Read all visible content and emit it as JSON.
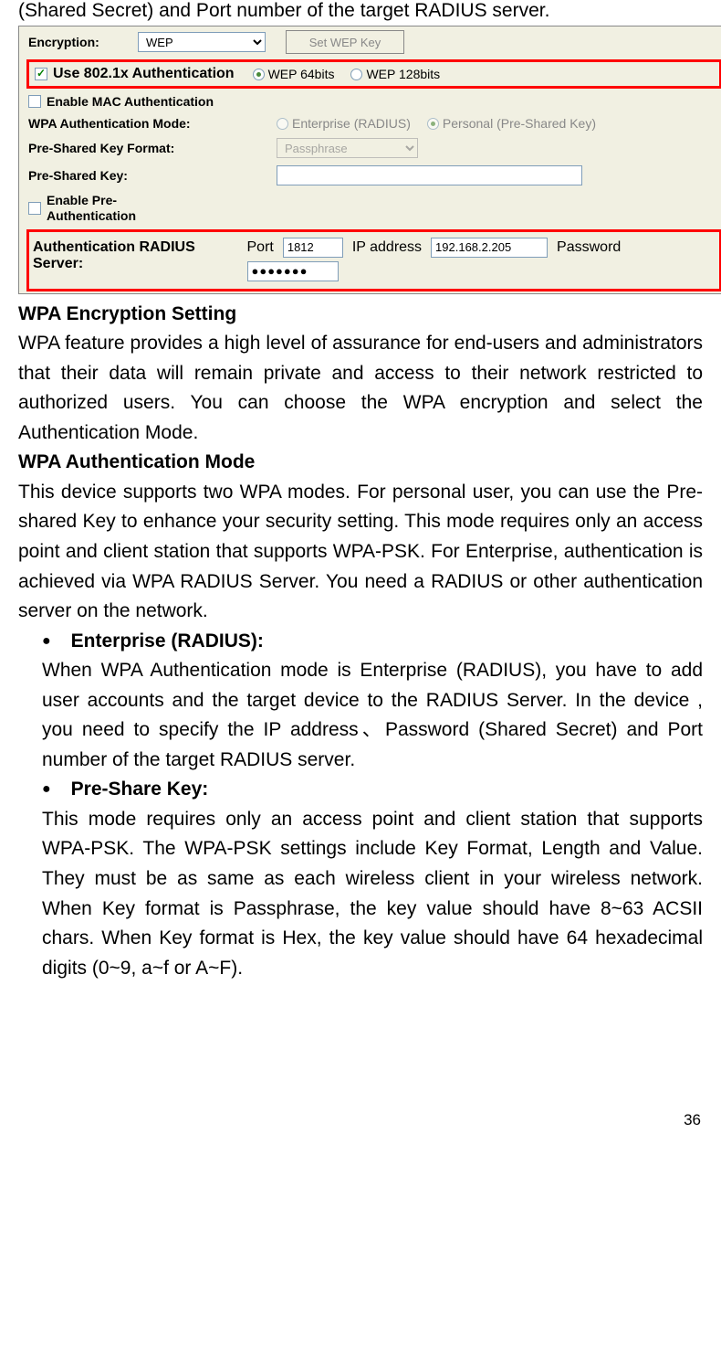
{
  "top_text": "(Shared Secret) and Port number of the target RADIUS server.",
  "ui": {
    "encryption_label": "Encryption:",
    "encryption_value": "WEP",
    "set_wep_button": "Set WEP Key",
    "use_8021x_label": "Use 802.1x Authentication",
    "wep_64": "WEP 64bits",
    "wep_128": "WEP 128bits",
    "enable_mac": "Enable MAC Authentication",
    "wpa_auth_mode_label": "WPA Authentication Mode:",
    "enterprise_label": "Enterprise (RADIUS)",
    "personal_label": "Personal (Pre-Shared Key)",
    "psk_format_label": "Pre-Shared Key Format:",
    "psk_format_value": "Passphrase",
    "psk_label": "Pre-Shared Key:",
    "psk_value": "",
    "enable_pre_auth_label": "Enable Pre-Authentication",
    "auth_radius_label": "Authentication RADIUS Server:",
    "port_label": "Port",
    "port_value": "1812",
    "ip_label": "IP address",
    "ip_value": "192.168.2.205",
    "password_label": "Password",
    "password_value": "●●●●●●●"
  },
  "doc": {
    "h1": "WPA Encryption Setting",
    "p1": "WPA feature provides a high level of assurance for end-users and administrators that their data will remain private and access to their network restricted to authorized users. You can choose the WPA encryption and select the Authentication Mode.",
    "h2": "WPA Authentication Mode",
    "p2": "This device supports two WPA modes. For personal user, you can use the Pre-shared Key to enhance your security setting. This mode requires only an access point and client station that supports WPA-PSK. For Enterprise, authentication is achieved via WPA RADIUS Server. You need a RADIUS or other authentication server on the network.",
    "b1_title": "Enterprise (RADIUS):",
    "b1_text": "When WPA Authentication mode is Enterprise (RADIUS), you have to add user accounts and the target device to the RADIUS Server. In the device , you need to specify the IP address、Password (Shared Secret) and Port number of the target RADIUS server.",
    "b2_title": "Pre-Share Key:",
    "b2_text": "This mode requires only an access point and client station that supports WPA-PSK. The WPA-PSK settings include Key Format, Length and Value. They must be as same as each wireless client in your wireless network. When Key format is Passphrase, the key value should have 8~63 ACSII chars. When Key format is Hex, the key value should have 64 hexadecimal digits (0~9, a~f or A~F)."
  },
  "page_number": "36"
}
